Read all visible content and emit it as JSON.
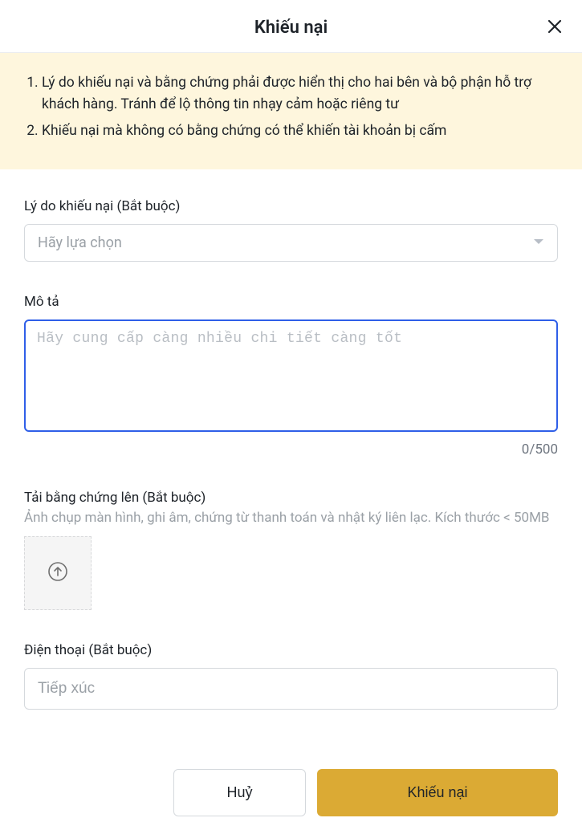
{
  "header": {
    "title": "Khiếu nại"
  },
  "notice": {
    "items": [
      "Lý do khiếu nại và bằng chứng phải được hiển thị cho hai bên và bộ phận hỗ trợ khách hàng. Tránh để lộ thông tin nhạy cảm hoặc riêng tư",
      " Khiếu nại mà không có bằng chứng có thể khiến tài khoản bị cấm"
    ]
  },
  "reason": {
    "label": "Lý do khiếu nại (Bắt buộc)",
    "placeholder": "Hãy lựa chọn"
  },
  "description": {
    "label": "Mô tả",
    "placeholder": "Hãy cung cấp càng nhiều chi tiết càng tốt",
    "char_count": "0/500",
    "value": ""
  },
  "upload": {
    "label": "Tải bằng chứng lên (Bắt buộc)",
    "help": "Ảnh chụp màn hình, ghi âm, chứng từ thanh toán và nhật ký liên lạc. Kích thước < 50MB"
  },
  "phone": {
    "label": "Điện thoại (Bắt buộc)",
    "placeholder": "Tiếp xúc",
    "value": ""
  },
  "footer": {
    "cancel": "Huỷ",
    "submit": "Khiếu nại"
  }
}
